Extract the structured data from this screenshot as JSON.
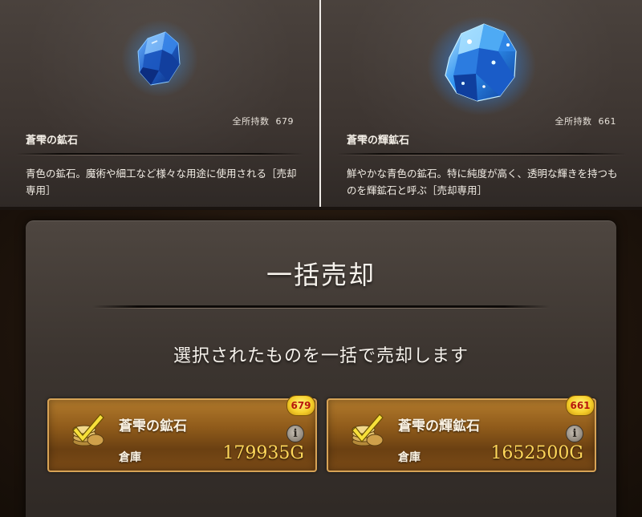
{
  "items": [
    {
      "owned_label": "全所持数",
      "owned_count": "679",
      "name": "蒼雫の鉱石",
      "description": "青色の鉱石。魔術や細工など様々な用途に使用される［売却専用］",
      "icon": "blue-ore-gem-icon"
    },
    {
      "owned_label": "全所持数",
      "owned_count": "661",
      "name": "蒼雫の輝鉱石",
      "description": "鮮やかな青色の鉱石。特に純度が高く、透明な輝きを持つものを輝鉱石と呼ぶ［売却専用］",
      "icon": "blue-shining-ore-gem-icon"
    }
  ],
  "dialog": {
    "title": "一括売却",
    "message": "選択されたものを一括で売却します",
    "cards": [
      {
        "name": "蒼雫の鉱石",
        "location": "倉庫",
        "price": "179935G",
        "count": "679",
        "info": "i",
        "icon": "gold-coins-check-icon"
      },
      {
        "name": "蒼雫の輝鉱石",
        "location": "倉庫",
        "price": "1652500G",
        "count": "661",
        "info": "i",
        "icon": "gold-coins-check-icon"
      }
    ]
  },
  "colors": {
    "gem_blue": "#2f7fe0",
    "gem_glow": "#4fb4ff",
    "card_gold": "#8e5a1a",
    "price_yellow": "#ffd75a",
    "badge_red_text": "#b8180e"
  }
}
